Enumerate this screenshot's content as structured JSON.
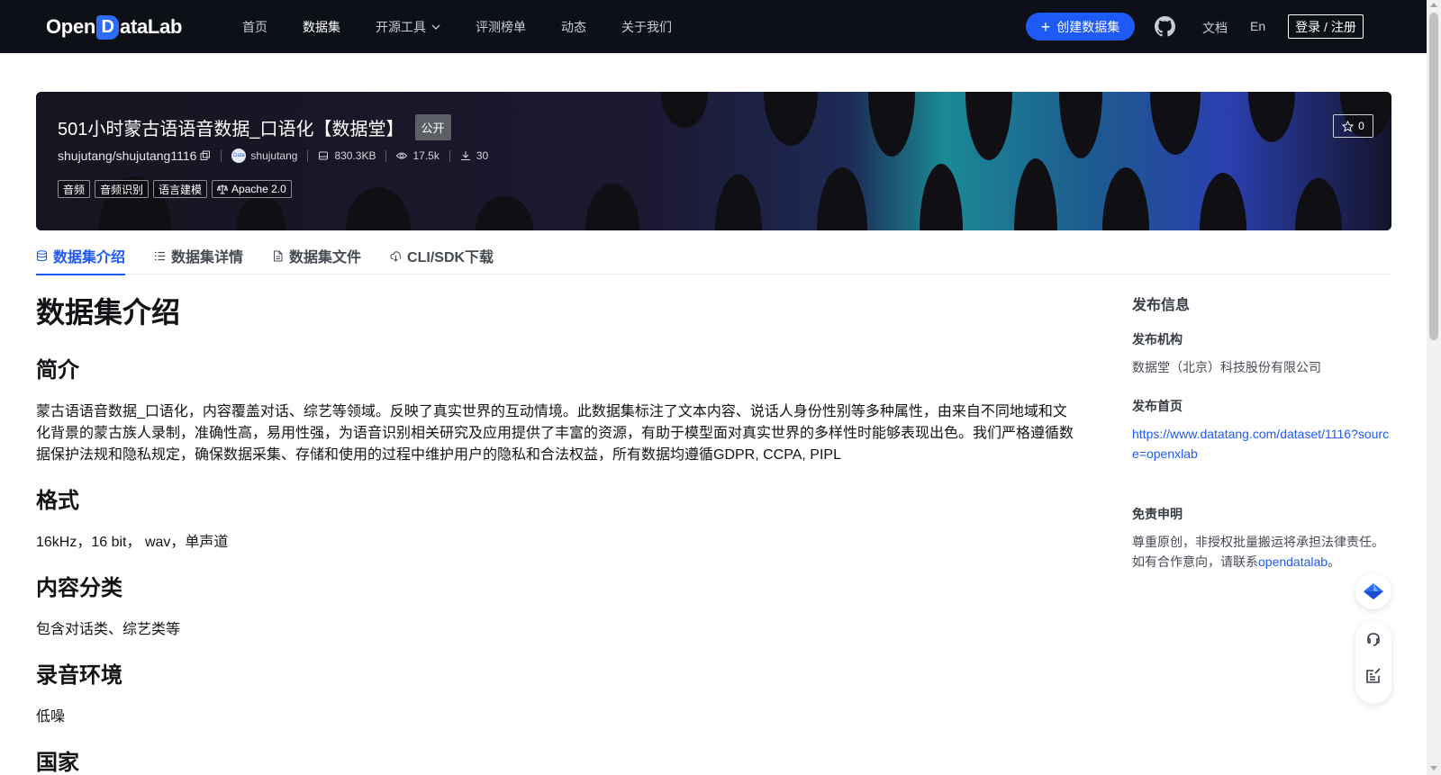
{
  "nav": {
    "logo_prefix": "Open",
    "logo_d": "D",
    "logo_suffix": "ataLab",
    "items": [
      {
        "label": "首页"
      },
      {
        "label": "数据集"
      },
      {
        "label": "开源工具"
      },
      {
        "label": "评测榜单"
      },
      {
        "label": "动态"
      },
      {
        "label": "关于我们"
      }
    ],
    "create_button": "创建数据集",
    "docs": "文档",
    "lang": "En",
    "login": "登录 / 注册"
  },
  "dataset": {
    "title": "501小时蒙古语语音数据_口语化【数据堂】",
    "visibility": "公开",
    "repo": "shujutang/shujutang1116",
    "owner": "shujutang",
    "avatar_text": "Data",
    "size": "830.3KB",
    "views": "17.5k",
    "downloads": "30",
    "stars": "0",
    "tags": [
      "音频",
      "音频识别",
      "语言建模"
    ],
    "license": "Apache 2.0"
  },
  "tabs": [
    {
      "label": "数据集介绍",
      "icon": "database-icon"
    },
    {
      "label": "数据集详情",
      "icon": "list-icon"
    },
    {
      "label": "数据集文件",
      "icon": "file-icon"
    },
    {
      "label": "CLI/SDK下载",
      "icon": "cloud-download-icon"
    }
  ],
  "content": {
    "heading": "数据集介绍",
    "sections": [
      {
        "title": "简介",
        "text": "蒙古语语音数据_口语化，内容覆盖对话、综艺等领域。反映了真实世界的互动情境。此数据集标注了文本内容、说话人身份性别等多种属性，由来自不同地域和文化背景的蒙古族人录制，准确性高，易用性强，为语音识别相关研究及应用提供了丰富的资源，有助于模型面对真实世界的多样性时能够表现出色。我们严格遵循数据保护法规和隐私规定，确保数据采集、存储和使用的过程中维护用户的隐私和合法权益，所有数据均遵循GDPR, CCPA, PIPL"
      },
      {
        "title": "格式",
        "text": "16kHz，16 bit， wav，单声道"
      },
      {
        "title": "内容分类",
        "text": "包含对话类、综艺类等"
      },
      {
        "title": "录音环境",
        "text": "低噪"
      },
      {
        "title": "国家",
        "text": ""
      }
    ]
  },
  "sidebar": {
    "title": "发布信息",
    "org_label": "发布机构",
    "org_value": "数据堂（北京）科技股份有限公司",
    "home_label": "发布首页",
    "home_url": "https://www.datatang.com/dataset/1116?source=openxlab",
    "disclaimer_label": "免责申明",
    "disclaimer_text": "尊重原创，非授权批量搬运将承担法律责任。如有合作意向，请联系",
    "disclaimer_link": "opendatalab",
    "disclaimer_end": "。"
  },
  "colors": {
    "nav_bg": "#0d1117",
    "accent": "#1e5af5",
    "banner_bg": "#15141d"
  }
}
